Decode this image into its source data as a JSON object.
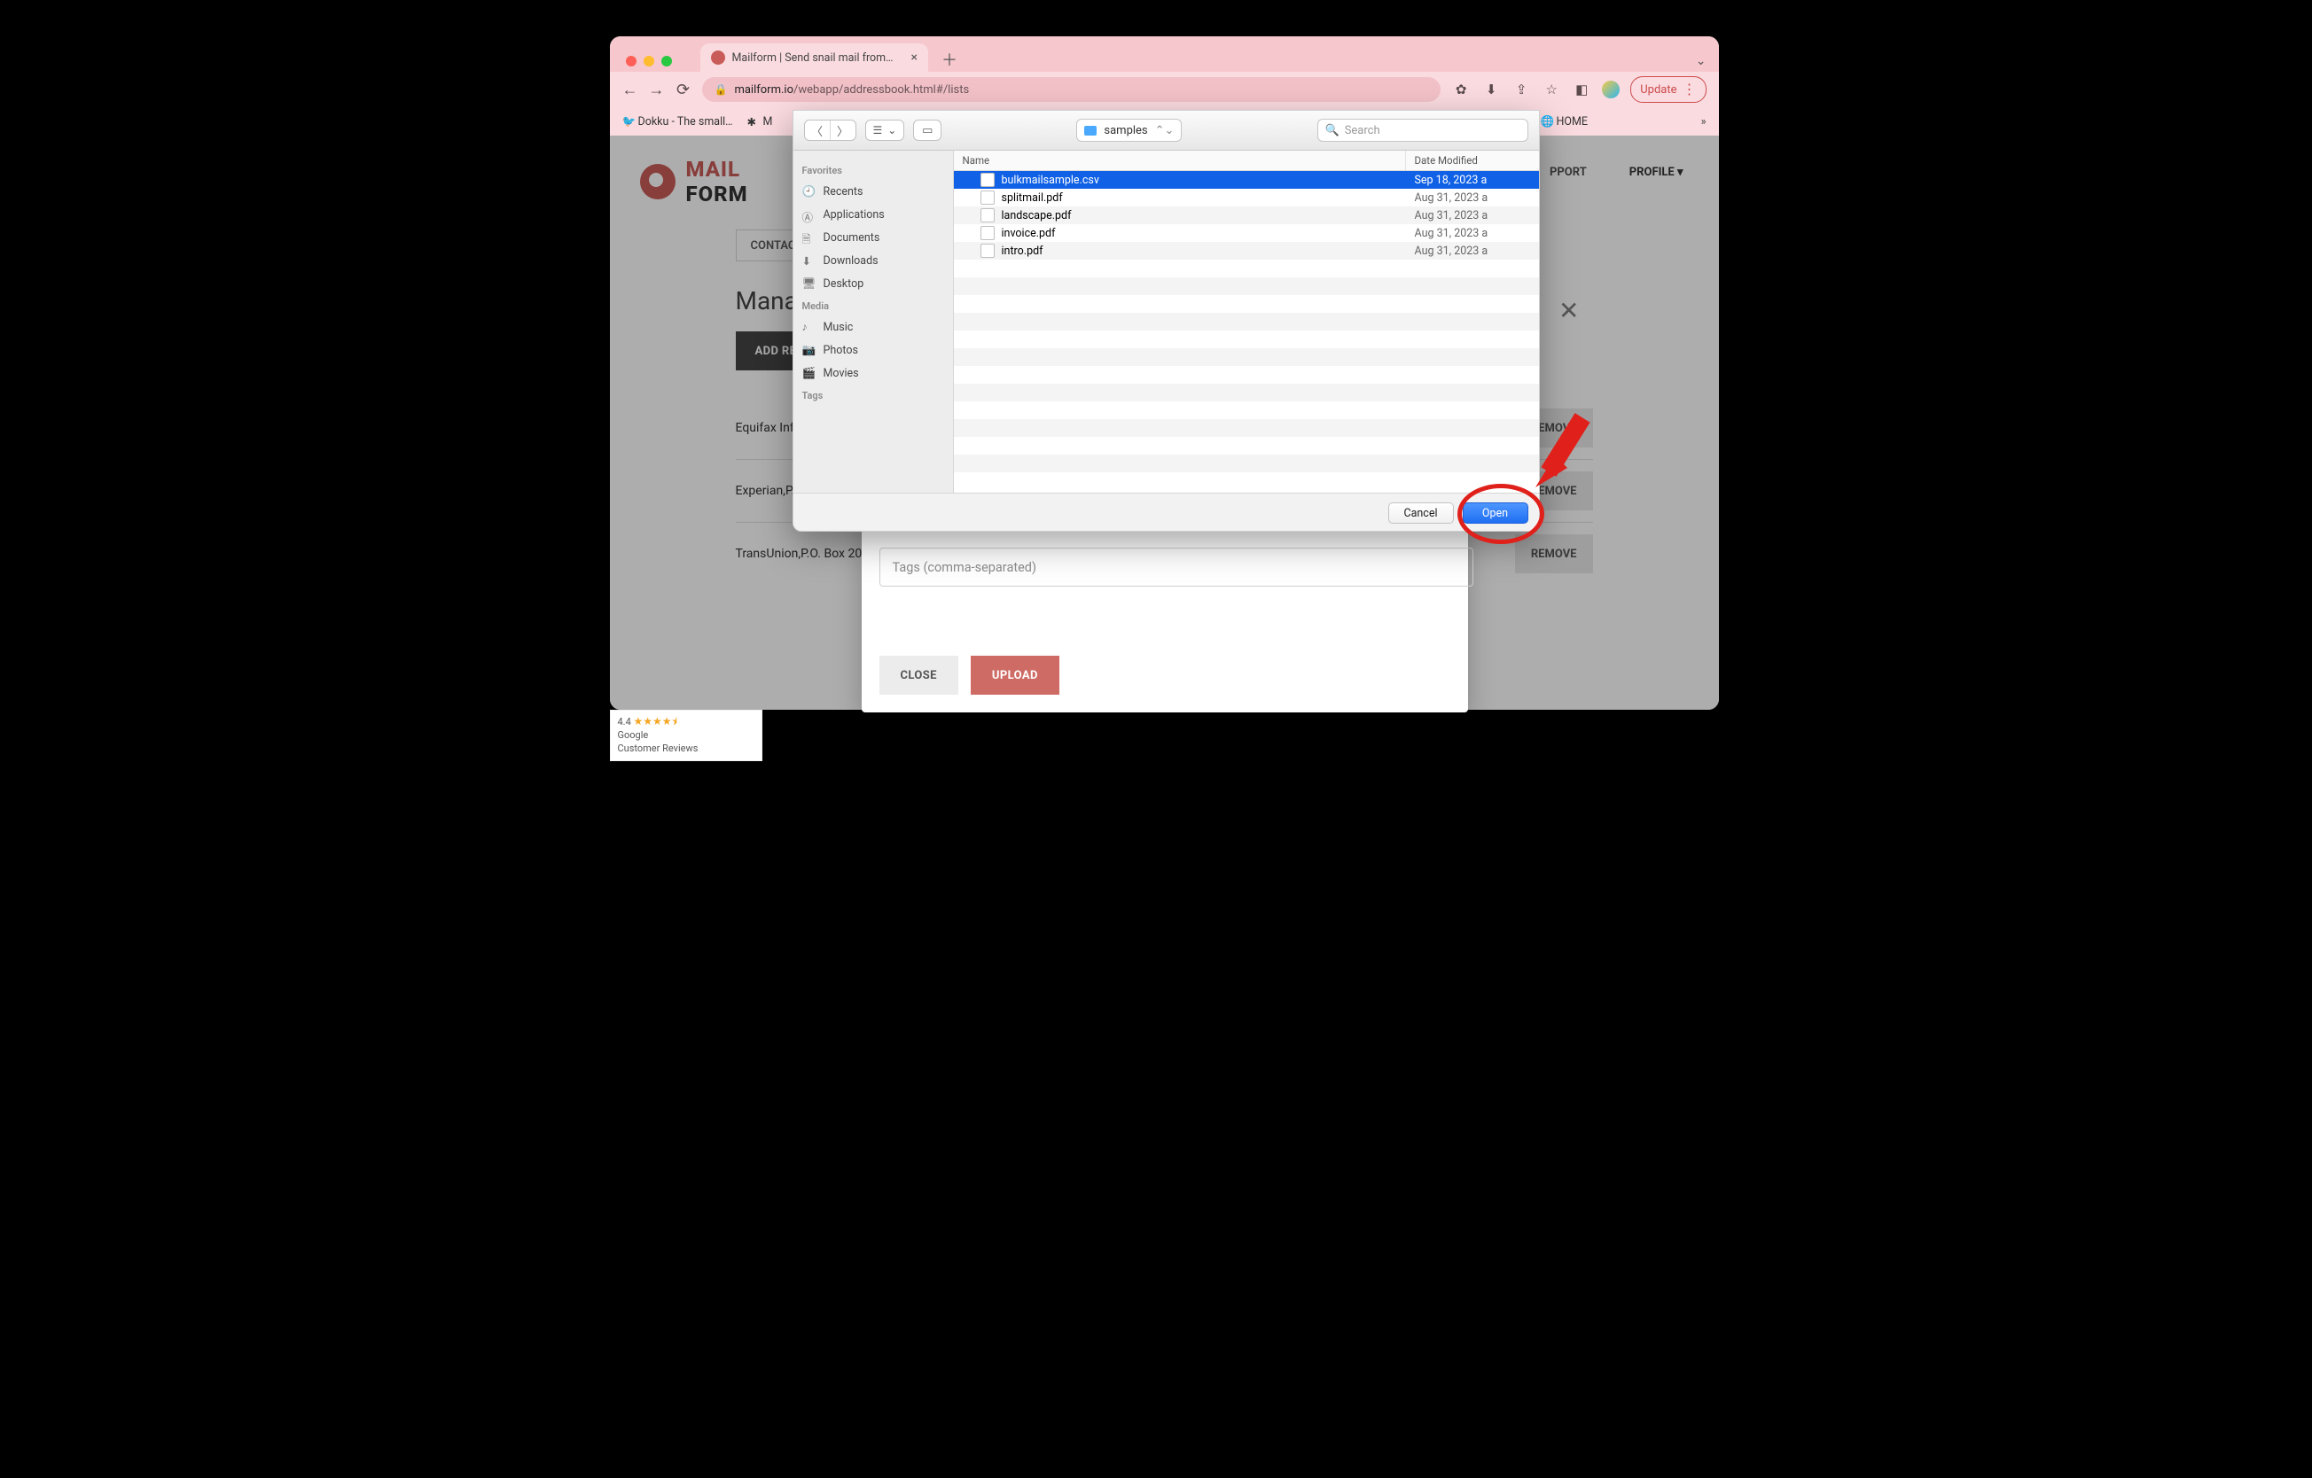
{
  "browser": {
    "tab_title": "Mailform | Send snail mail from…",
    "url_domain": "mailform.io",
    "url_path": "/webapp/addressbook.html#/lists",
    "update_label": "Update",
    "bookmarks": {
      "dokku": "Dokku - The small…",
      "m": "M",
      "home": "HOME",
      "more": "»"
    }
  },
  "page": {
    "brand": {
      "first": "MAIL",
      "second": "FORM"
    },
    "nav": {
      "support": "PPORT",
      "profile": "PROFILE ▾"
    },
    "tabs": {
      "contacts": "CONTACT"
    },
    "heading": "Manage",
    "add_button": "ADD RE",
    "rows": [
      "Equifax Inf",
      "Experian,P.",
      "TransUnion,P.O. Box 20"
    ],
    "remove_label": "REMOVE",
    "modal": {
      "tags_placeholder": "Tags (comma-separated)",
      "close_btn": "CLOSE",
      "upload_btn": "UPLOAD"
    }
  },
  "file_dialog": {
    "folder_name": "samples",
    "search_placeholder": "Search",
    "sidebar": {
      "favorites_header": "Favorites",
      "favorites": [
        "Recents",
        "Applications",
        "Documents",
        "Downloads",
        "Desktop"
      ],
      "media_header": "Media",
      "media": [
        "Music",
        "Photos",
        "Movies"
      ],
      "tags_header": "Tags"
    },
    "columns": {
      "name": "Name",
      "date": "Date Modified"
    },
    "files": [
      {
        "name": "bulkmailsample.csv",
        "date": "Sep 18, 2023 a",
        "selected": true,
        "type": "csv"
      },
      {
        "name": "splitmail.pdf",
        "date": "Aug 31, 2023 a",
        "selected": false,
        "type": "pdf"
      },
      {
        "name": "landscape.pdf",
        "date": "Aug 31, 2023 a",
        "selected": false,
        "type": "pdf"
      },
      {
        "name": "invoice.pdf",
        "date": "Aug 31, 2023 a",
        "selected": false,
        "type": "pdf"
      },
      {
        "name": "intro.pdf",
        "date": "Aug 31, 2023 a",
        "selected": false,
        "type": "pdf"
      }
    ],
    "buttons": {
      "cancel": "Cancel",
      "open": "Open"
    }
  },
  "badge": {
    "rating": "4.4",
    "line1": "Google",
    "line2": "Customer Reviews"
  }
}
